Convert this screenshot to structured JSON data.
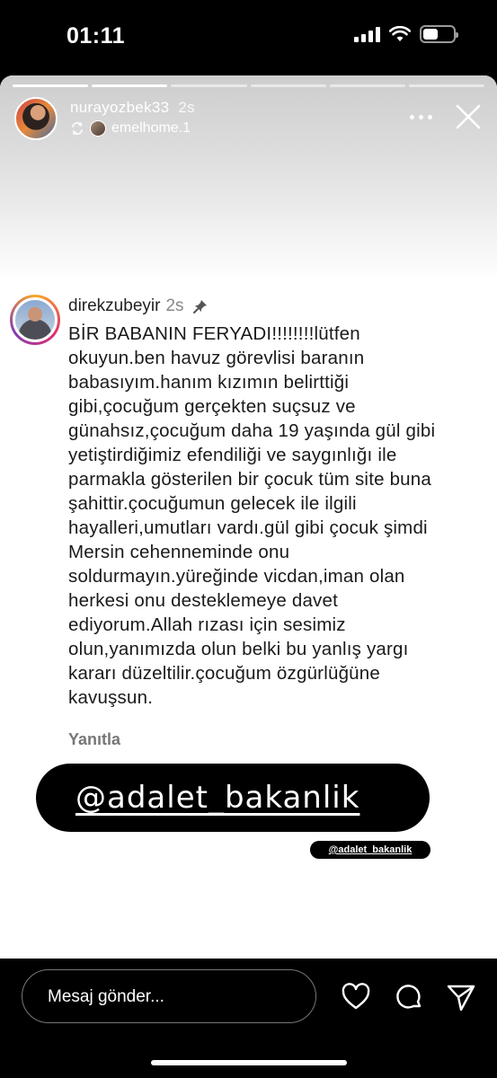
{
  "status_bar": {
    "time": "01:11",
    "battery_level": 0.5
  },
  "story": {
    "progress": {
      "segments": 6,
      "active_index": 2
    },
    "username": "nurayozbek33",
    "time": "2s",
    "reposted_from": "emelhome.1"
  },
  "comment": {
    "username": "direkzubeyir",
    "time": "2s",
    "lines": [
      "BİR BABANIN FERYADI!!!!!!!!lütfen",
      "okuyun.ben havuz görevlisi baranın",
      "babasıyım.hanım kızımın belirttiği",
      "gibi,çocuğum gerçekten suçsuz ve",
      "günahsız,çocuğum daha 19 yaşında gül gibi",
      "yetiştirdiğimiz efendiliği ve saygınlığı ile",
      "parmakla gösterilen bir çocuk tüm site buna",
      "şahittir.çocuğumun gelecek ile ilgili",
      "hayalleri,umutları vardı.gül gibi çocuk şimdi",
      "Mersin cehenneminde onu",
      "soldurmayın.yüreğinde vicdan,iman olan",
      "herkesi onu desteklemeye davet",
      "ediyorum.Allah rızası için sesimiz",
      "olun,yanımızda olun belki bu yanlış yargı",
      "kararı düzeltilir.çocuğum özgürlüğüne",
      "kavuşsun."
    ],
    "reply_label": "Yanıtla"
  },
  "mention": {
    "big": "@adalet_bakanlik",
    "small": "@adalet_bakanlik"
  },
  "bottom": {
    "placeholder": "Mesaj gönder..."
  }
}
